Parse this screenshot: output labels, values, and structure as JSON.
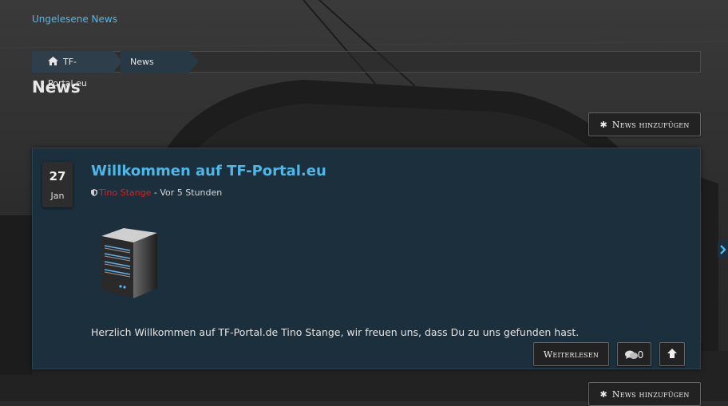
{
  "top_link": "Ungelesene News",
  "breadcrumb": {
    "home": "TF-Portal.eu",
    "current": "News"
  },
  "page_title": "News",
  "add_news_label": "News hinzufügen",
  "add_news_icon": "✱",
  "article": {
    "day": "27",
    "month": "Jan",
    "title": "Willkommen auf TF-Portal.eu",
    "author": "Tino Stange",
    "time": "- Vor 5 Stunden",
    "excerpt": "Herzlich Willkommen auf TF-Portal.de Tino Stange, wir freuen uns, dass Du zu uns gefunden hast.",
    "read_more": "Weiterlesen",
    "comment_count": "0"
  },
  "colors": {
    "accent": "#4fb6e6",
    "author": "#e02020",
    "panel": "#1b2f3d"
  }
}
